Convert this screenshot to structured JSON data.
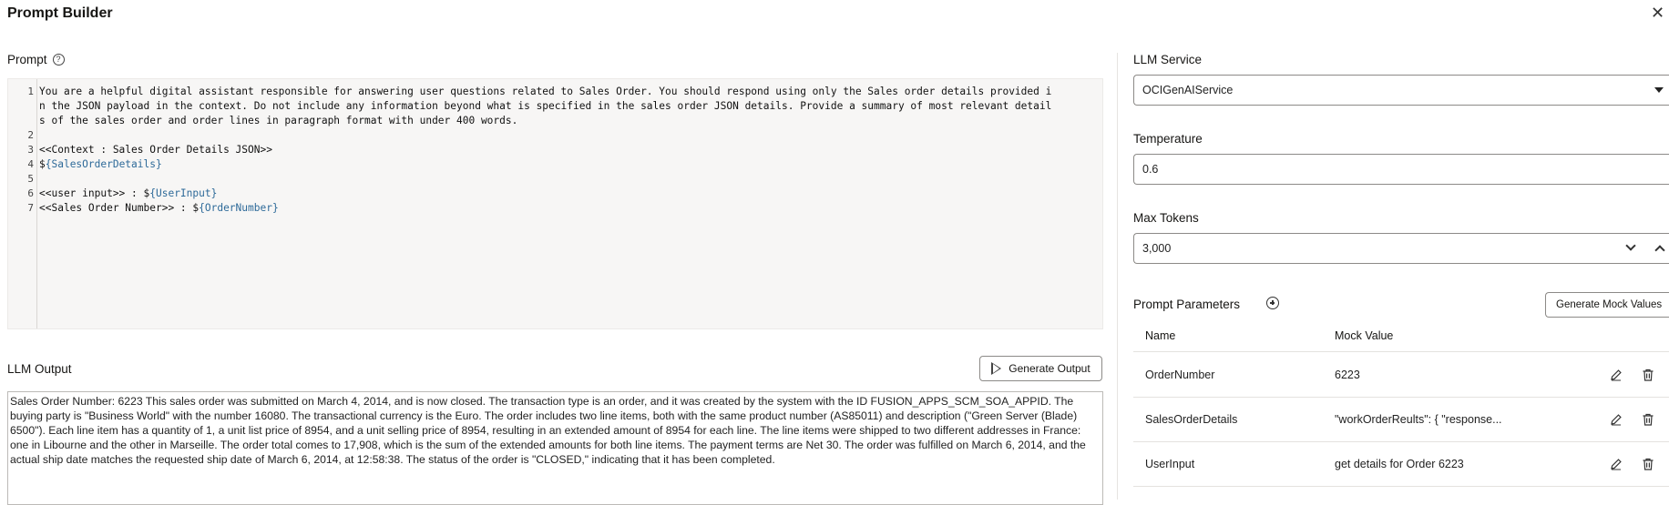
{
  "dialog": {
    "title": "Prompt Builder",
    "close_icon": "close-icon"
  },
  "prompt": {
    "label": "Prompt",
    "help_icon": "help-icon",
    "lines": [
      {
        "n": "1",
        "segments": [
          {
            "t": "You are a helpful digital assistant responsible for answering user questions related to Sales Order. You should respond using only the Sales order details provided i"
          }
        ]
      },
      {
        "n": "",
        "segments": [
          {
            "t": "n the JSON payload in the context. Do not include any information beyond what is specified in the sales order JSON details. Provide a summary of most relevant detail"
          }
        ]
      },
      {
        "n": "",
        "segments": [
          {
            "t": "s of the sales order and order lines in paragraph format with under 400 words."
          }
        ]
      },
      {
        "n": "2",
        "segments": [
          {
            "t": ""
          }
        ]
      },
      {
        "n": "3",
        "segments": [
          {
            "t": "<<Context : Sales Order Details JSON>>"
          }
        ]
      },
      {
        "n": "4",
        "segments": [
          {
            "t": "$"
          },
          {
            "t": "{SalesOrderDetails}",
            "v": true
          }
        ]
      },
      {
        "n": "5",
        "segments": [
          {
            "t": ""
          }
        ]
      },
      {
        "n": "6",
        "segments": [
          {
            "t": "<<user input>> : $"
          },
          {
            "t": "{UserInput}",
            "v": true
          }
        ]
      },
      {
        "n": "7",
        "segments": [
          {
            "t": "<<Sales Order Number>> : $"
          },
          {
            "t": "{OrderNumber}",
            "v": true
          }
        ]
      }
    ]
  },
  "output": {
    "label": "LLM Output",
    "generate_button": "Generate Output",
    "text": "Sales Order Number: 6223 This sales order was submitted on March 4, 2014, and is now closed. The transaction type is an order, and it was created by the system with the ID FUSION_APPS_SCM_SOA_APPID. The buying party is \"Business World\" with the number 16080. The transactional currency is the Euro. The order includes two line items, both with the same product number (AS85011) and description (\"Green Server (Blade) 6500\"). Each line item has a quantity of 1, a unit list price of 8954, and a unit selling price of 8954, resulting in an extended amount of 8954 for each line. The line items were shipped to two different addresses in France: one in Libourne and the other in Marseille. The order total comes to 17,908, which is the sum of the extended amounts for both line items. The payment terms are Net 30. The order was fulfilled on March 6, 2014, and the actual ship date matches the requested ship date of March 6, 2014, at 12:58:38. The status of the order is \"CLOSED,\" indicating that it has been completed."
  },
  "settings": {
    "llm_service_label": "LLM Service",
    "llm_service_value": "OCIGenAIService",
    "temperature_label": "Temperature",
    "temperature_value": "0.6",
    "max_tokens_label": "Max Tokens",
    "max_tokens_value": "3,000"
  },
  "params": {
    "label": "Prompt Parameters",
    "generate_mock_button": "Generate Mock Values",
    "columns": [
      "Name",
      "Mock Value"
    ],
    "rows": [
      {
        "name": "OrderNumber",
        "value": "6223"
      },
      {
        "name": "SalesOrderDetails",
        "value": "\"workOrderReults\": { \"response..."
      },
      {
        "name": "UserInput",
        "value": "get details for Order 6223"
      }
    ]
  },
  "colors": {
    "accent_var": "#2e6a99",
    "border": "#8c8a87"
  }
}
